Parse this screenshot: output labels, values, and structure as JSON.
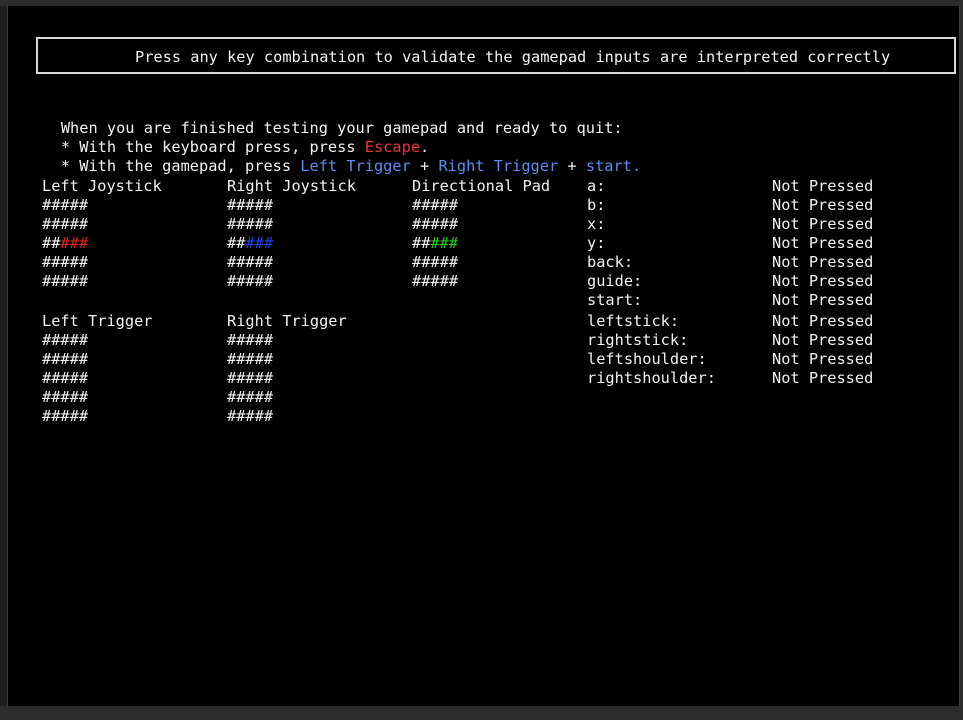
{
  "banner": {
    "text": "Press any key combination to validate the gamepad inputs are interpreted correctly"
  },
  "instructions": {
    "intro": "When you are finished testing your gamepad and ready to quit:",
    "keyboard_prefix": "* With the keyboard press, press ",
    "keyboard_key": "Escape",
    "keyboard_suffix": ".",
    "gamepad_prefix": "* With the gamepad, press ",
    "gamepad_key1": "Left Trigger",
    "plus": " + ",
    "gamepad_key2": "Right Trigger",
    "gamepad_key3": "start",
    "gamepad_suffix": "."
  },
  "panels": {
    "left_joystick": {
      "label": "Left Joystick",
      "row": "#####",
      "active_prefix": "##",
      "active_suffix": "###",
      "active_color": "#e82020"
    },
    "right_joystick": {
      "label": "Right Joystick",
      "row": "#####",
      "active_prefix": "##",
      "active_suffix": "###",
      "active_color": "#2244ee"
    },
    "directional_pad": {
      "label": "Directional Pad",
      "row": "#####",
      "active_prefix": "##",
      "active_suffix": "###",
      "active_color": "#22cc22"
    },
    "left_trigger": {
      "label": "Left Trigger",
      "row": "#####"
    },
    "right_trigger": {
      "label": "Right Trigger",
      "row": "#####"
    }
  },
  "buttons": [
    {
      "name": "a:",
      "state": "Not Pressed"
    },
    {
      "name": "b:",
      "state": "Not Pressed"
    },
    {
      "name": "x:",
      "state": "Not Pressed"
    },
    {
      "name": "y:",
      "state": "Not Pressed"
    },
    {
      "name": "back:",
      "state": "Not Pressed"
    },
    {
      "name": "guide:",
      "state": "Not Pressed"
    },
    {
      "name": "start:",
      "state": "Not Pressed"
    },
    {
      "name": "leftstick:",
      "state": "Not Pressed"
    },
    {
      "name": "rightstick:",
      "state": "Not Pressed"
    },
    {
      "name": "leftshoulder:",
      "state": "Not Pressed"
    },
    {
      "name": "rightshoulder:",
      "state": "Not Pressed"
    }
  ],
  "colors": {
    "escape": "#e8363a",
    "gamepad_keys": "#5b8cf0",
    "background": "#000000",
    "text": "#f2f2f2"
  }
}
